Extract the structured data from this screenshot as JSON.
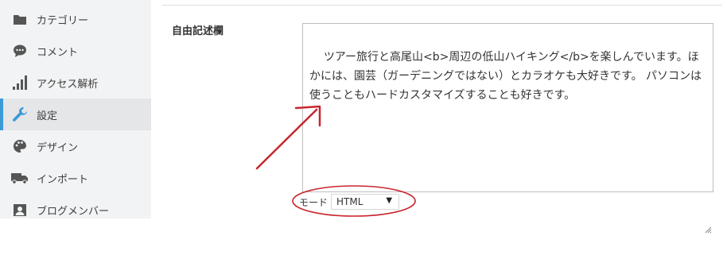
{
  "sidebar": {
    "items": [
      {
        "label": "カテゴリー",
        "icon": "folder-icon"
      },
      {
        "label": "コメント",
        "icon": "comment-icon"
      },
      {
        "label": "アクセス解析",
        "icon": "bar-chart-icon"
      },
      {
        "label": "設定",
        "icon": "wrench-icon",
        "active": true
      },
      {
        "label": "デザイン",
        "icon": "palette-icon"
      },
      {
        "label": "インポート",
        "icon": "truck-icon"
      },
      {
        "label": "ブログメンバー",
        "icon": "member-icon"
      }
    ]
  },
  "main": {
    "field_label": "自由記述欄",
    "textarea_value": "ツアー旅行と高尾山<b>周辺の低山ハイキング</b>を楽しんでいます。ほかには、園芸（ガーデニングではない）とカラオケも大好きです。 パソコンは使うこともハードカスタマイズすることも好きです。",
    "mode_label": "モード",
    "mode_value": "HTML"
  },
  "colors": {
    "accent": "#3c9ad6",
    "annotation": "#c8262e",
    "sidebar_bg": "#f2f3f4",
    "active_bg": "#e4e6e8"
  }
}
